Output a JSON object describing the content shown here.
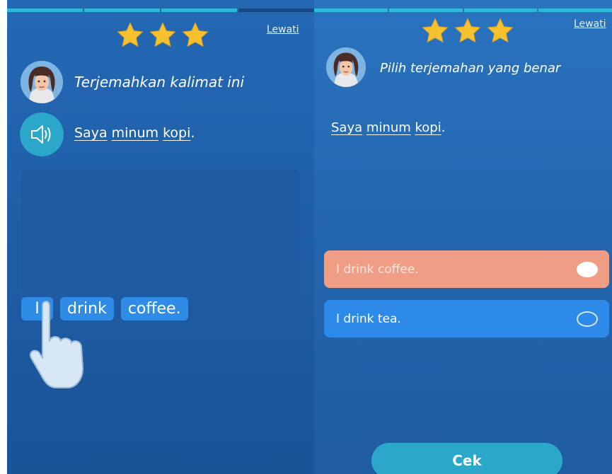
{
  "left_screen": {
    "skip_label": "Lewati",
    "star_count": 3,
    "instruction": "Terjemahkan kalimat ini",
    "sentence": {
      "words": [
        "Saya",
        "minum",
        "kopi"
      ],
      "punct": "."
    },
    "word_chips": [
      "I",
      "drink",
      "coffee."
    ]
  },
  "right_screen": {
    "skip_label": "Lewati",
    "star_count": 3,
    "instruction": "Pilih terjemahan yang benar",
    "sentence": {
      "words": [
        "Saya",
        "minum",
        "kopi"
      ],
      "punct": "."
    },
    "options": [
      {
        "label": "I drink coffee.",
        "selected": true
      },
      {
        "label": "I drink tea.",
        "selected": false
      }
    ],
    "check_button": "Cek"
  },
  "colors": {
    "star": "#f6c12e",
    "accent_teal": "#2aa7c9",
    "selected_option": "#ef9e85",
    "option_blue": "#2e8ae8"
  },
  "icons": [
    "star-icon",
    "avatar-woman-icon",
    "speaker-icon",
    "pointing-hand-icon",
    "radio-on-icon",
    "radio-off-icon"
  ]
}
